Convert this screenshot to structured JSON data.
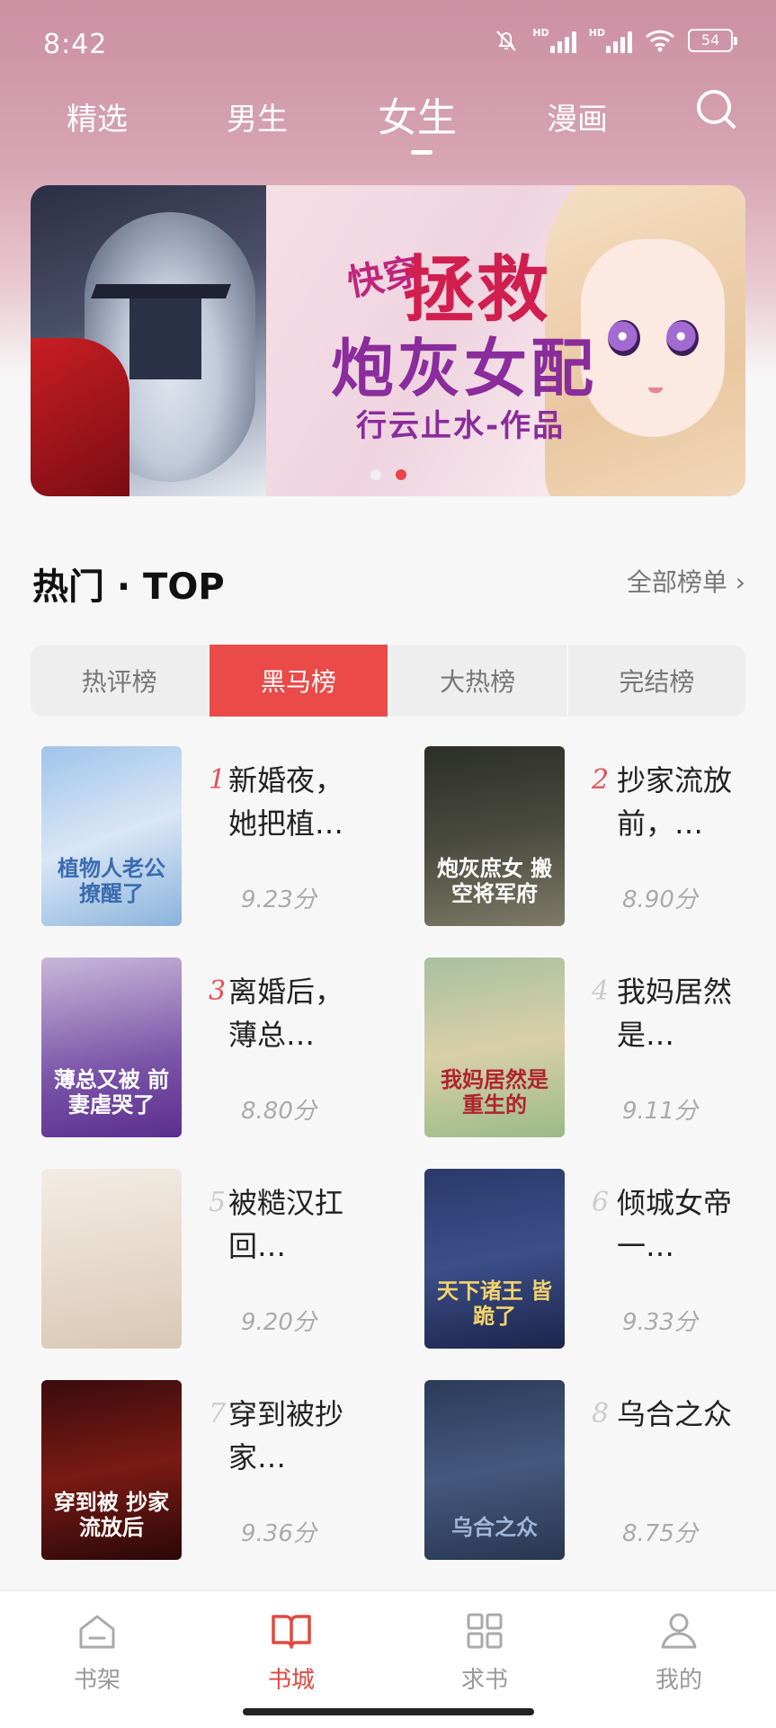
{
  "status_bar": {
    "time": "8:42",
    "battery": "54"
  },
  "nav": {
    "tabs": [
      {
        "label": "精选"
      },
      {
        "label": "男生"
      },
      {
        "label": "女生"
      },
      {
        "label": "漫画"
      }
    ],
    "active_index": 2
  },
  "banner": {
    "title_small": "快穿",
    "title_big_1": "拯救",
    "title_big_2": "炮灰女配",
    "author": "行云止水-作品",
    "page_count": 2,
    "active_page": 2
  },
  "section": {
    "title": "热门 · TOP",
    "more": "全部榜单 ›"
  },
  "rank_tabs": [
    {
      "label": "热评榜"
    },
    {
      "label": "黑马榜"
    },
    {
      "label": "大热榜"
    },
    {
      "label": "完结榜"
    }
  ],
  "books": [
    {
      "rank": "1",
      "title": "新婚夜，她把植…",
      "score": "9.23分",
      "cover_text": "植物人老公 撩醒了"
    },
    {
      "rank": "2",
      "title": "抄家流放前，…",
      "score": "8.90分",
      "cover_text": "炮灰庶女 搬空将军府"
    },
    {
      "rank": "3",
      "title": "离婚后，薄总…",
      "score": "8.80分",
      "cover_text": "薄总又被 前妻虐哭了"
    },
    {
      "rank": "4",
      "title": "我妈居然是…",
      "score": "9.11分",
      "cover_text": "我妈居然是 重生的"
    },
    {
      "rank": "5",
      "title": "被糙汉扛回…",
      "score": "9.20分",
      "cover_text": ""
    },
    {
      "rank": "6",
      "title": "倾城女帝一…",
      "score": "9.33分",
      "cover_text": "天下诸王 皆跪了"
    },
    {
      "rank": "7",
      "title": "穿到被抄家…",
      "score": "9.36分",
      "cover_text": "穿到被 抄家流放后"
    },
    {
      "rank": "8",
      "title": "乌合之众",
      "score": "8.75分",
      "cover_text": "乌合之众"
    }
  ],
  "bottom_nav": [
    {
      "label": "书架"
    },
    {
      "label": "书城"
    },
    {
      "label": "求书"
    },
    {
      "label": "我的"
    }
  ],
  "colors": {
    "accent": "#ea4a48",
    "header_pink": "#cc8fa3"
  }
}
